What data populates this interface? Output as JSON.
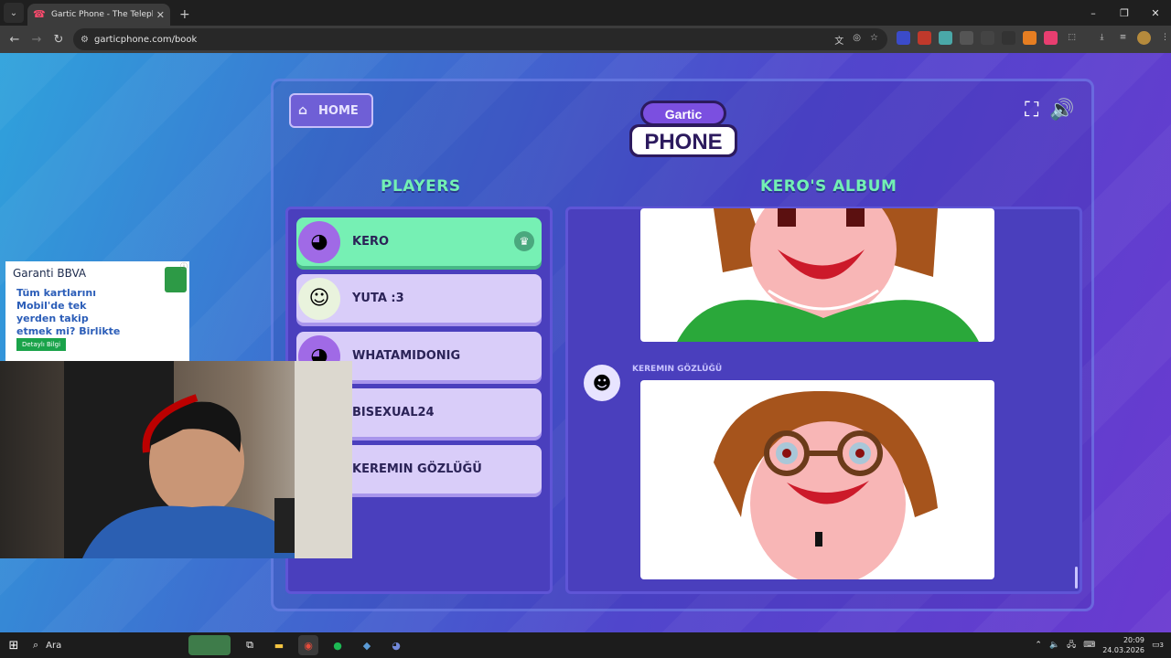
{
  "browser": {
    "tab_title": "Gartic Phone - The Telephone G",
    "url": "garticphone.com/book",
    "window_controls": [
      "–",
      "❐",
      "✕"
    ]
  },
  "header": {
    "home_label": "HOME",
    "logo_top": "Gartic",
    "logo_main": "PHONE"
  },
  "players": {
    "heading": "PLAYERS",
    "list": [
      {
        "name": "KERO",
        "active": true
      },
      {
        "name": "YUTA :3",
        "active": false
      },
      {
        "name": "WHATAMIDONIG",
        "active": false
      },
      {
        "name": "BISEXUAL24",
        "active": false
      },
      {
        "name": "KEREMIN GÖZLÜĞÜ",
        "active": false
      }
    ]
  },
  "album": {
    "heading": "KERO'S ALBUM",
    "entries": [
      {
        "author": "KEREMIN GÖZLÜĞÜ"
      }
    ]
  },
  "ad": {
    "brand": "Garanti BBVA",
    "text": "Tüm kartlarını Mobil'de tek yerden takip etmek mi? Birlikte yaparız!",
    "cta": "Detaylı Bilgi"
  },
  "taskbar": {
    "search_label": "Ara",
    "time": "20:09",
    "date": "24.03.2026",
    "notifications": "3"
  }
}
